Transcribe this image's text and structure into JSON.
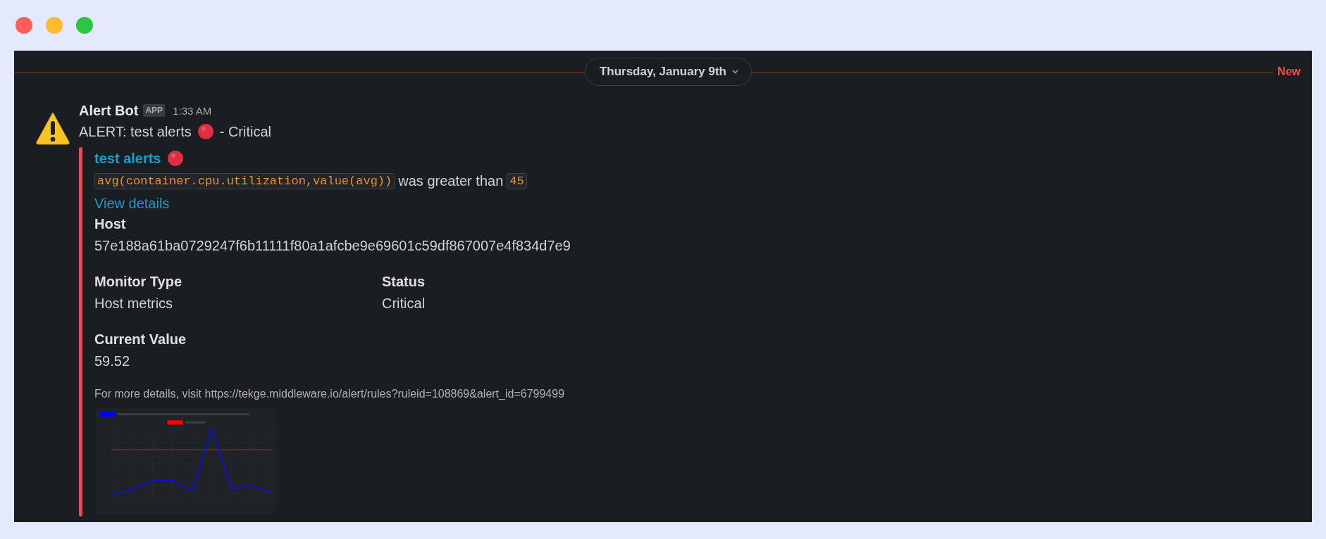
{
  "divider": {
    "date": "Thursday, January 9th",
    "new_label": "New"
  },
  "message": {
    "sender": "Alert Bot",
    "badge": "APP",
    "time": "1:33 AM",
    "text_before": "ALERT: test alerts",
    "text_after": "- Critical"
  },
  "attachment": {
    "title": "test alerts",
    "code": "avg(container.cpu.utilization,value(avg))",
    "condition": "was greater than",
    "threshold": "45",
    "link": "View details",
    "fields": [
      {
        "title": "Host",
        "value": "57e188a61ba0729247f6b11111f80a1afcbe9e69601c59df867007e4f834d7e9",
        "short": false
      },
      {
        "title": "Monitor Type",
        "value": "Host metrics",
        "short": true
      },
      {
        "title": "Status",
        "value": "Critical",
        "short": true
      },
      {
        "title": "Current Value",
        "value": "59.52",
        "short": false
      }
    ],
    "footer": "For more details, visit https://tekge.middleware.io/alert/rules?ruleid=108869&alert_id=6799499"
  }
}
